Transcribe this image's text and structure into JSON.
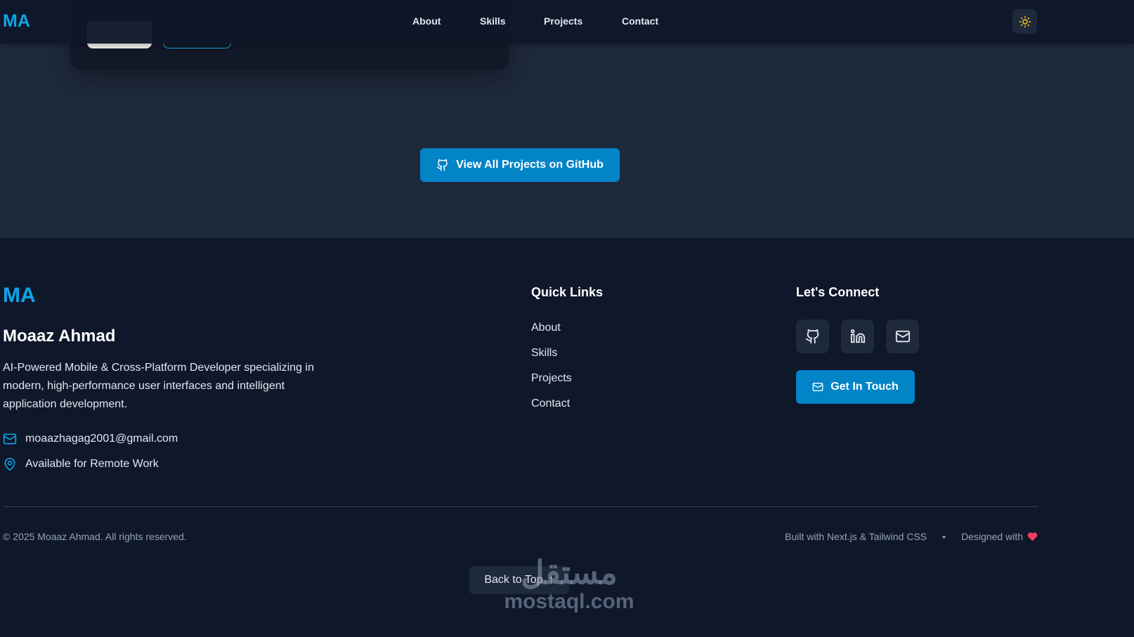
{
  "nav": {
    "logo": "MA",
    "links": [
      "About",
      "Skills",
      "Projects",
      "Contact"
    ]
  },
  "projects": {
    "github_button": "View All Projects on GitHub"
  },
  "footer": {
    "logo": "MA",
    "name": "Moaaz Ahmad",
    "description": "AI-Powered Mobile & Cross-Platform Developer specializing in modern, high-performance user interfaces and intelligent application development.",
    "email": "moaazhagag2001@gmail.com",
    "location": "Available for Remote Work",
    "quick_links_title": "Quick Links",
    "quick_links": [
      "About",
      "Skills",
      "Projects",
      "Contact"
    ],
    "connect_title": "Let's Connect",
    "get_in_touch": "Get In Touch",
    "copyright": "© 2025 Moaaz Ahmad. All rights reserved.",
    "built_with": "Built with Next.js & Tailwind CSS",
    "separator": "•",
    "designed_with": "Designed with",
    "back_to_top": "Back to Top"
  },
  "watermark": {
    "arabic": "مستقل",
    "latin": "mostaql.com"
  },
  "colors": {
    "accent": "#0ea5e9",
    "button": "#0284c7",
    "heart": "#f43f5e"
  }
}
